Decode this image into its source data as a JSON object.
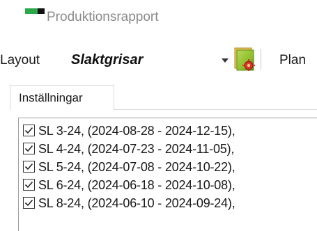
{
  "window": {
    "title": "Produktionsrapport",
    "icon": "app-status-icon"
  },
  "toolbar": {
    "layout_label": "Layout",
    "layout_value": "Slaktgrisar",
    "plan_label": "Plan",
    "plan_icon": "plan-document-icon"
  },
  "tabs": [
    {
      "label": "Inställningar",
      "selected": true
    }
  ],
  "list": {
    "items": [
      {
        "label": "SL 3-24, (2024-08-28 - 2024-12-15),",
        "checked": true
      },
      {
        "label": "SL 4-24, (2024-07-23 - 2024-11-05),",
        "checked": true
      },
      {
        "label": "SL 5-24, (2024-07-08 - 2024-10-22),",
        "checked": true
      },
      {
        "label": "SL 6-24, (2024-06-18 - 2024-10-08),",
        "checked": true
      },
      {
        "label": "SL 8-24, (2024-06-10 - 2024-09-24),",
        "checked": true
      }
    ]
  },
  "colors": {
    "accent_green": "#2aa84a",
    "title_gray": "#8a8a8a",
    "border_gray": "#d9d9d9"
  }
}
